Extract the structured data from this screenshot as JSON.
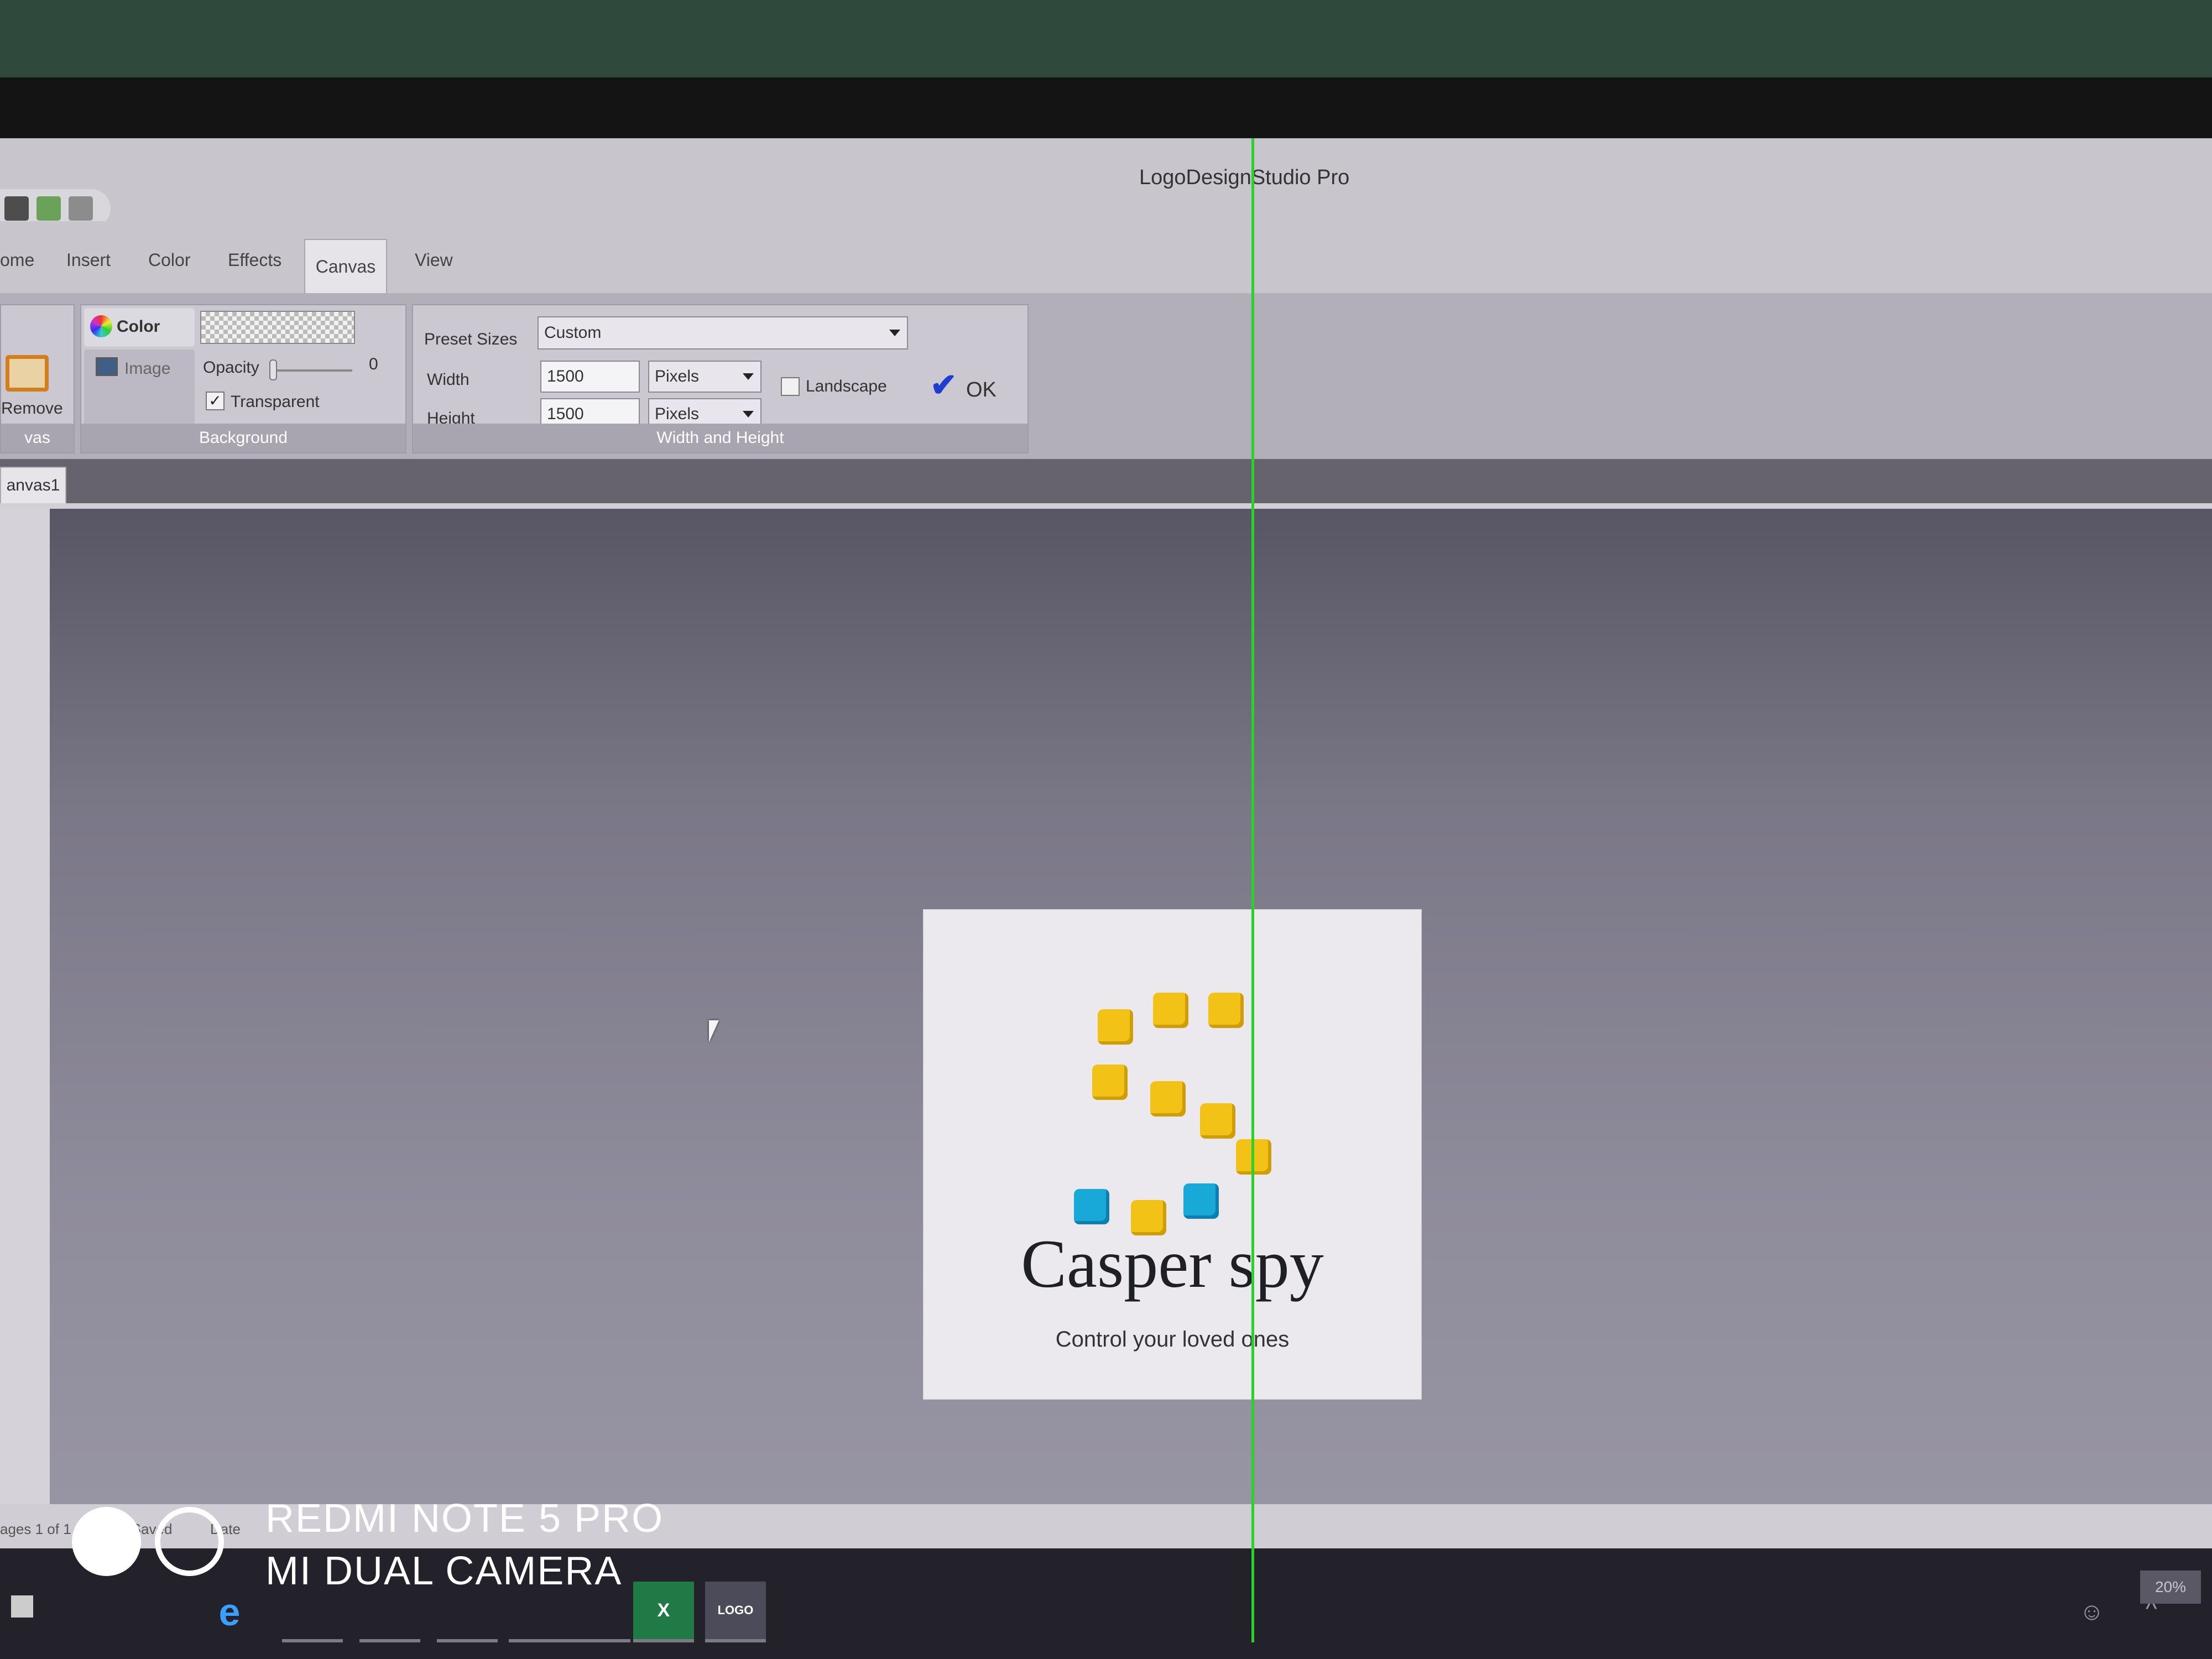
{
  "app": {
    "title": "LogoDesignStudio Pro"
  },
  "ribbon_tabs": [
    "ome",
    "Insert",
    "Color",
    "Effects",
    "Canvas",
    "View"
  ],
  "canvas_group": {
    "remove_label": "Remove",
    "group_label": "vas"
  },
  "background_group": {
    "color_label": "Color",
    "image_label": "Image",
    "opacity_label": "Opacity",
    "opacity_value": "0",
    "transparent_label": "Transparent",
    "transparent_checked": true,
    "group_label": "Background"
  },
  "size_group": {
    "preset_label": "Preset Sizes",
    "preset_value": "Custom",
    "width_label": "Width",
    "width_value": "1500",
    "width_unit": "Pixels",
    "height_label": "Height",
    "height_value": "1500",
    "height_unit": "Pixels",
    "landscape_label": "Landscape",
    "landscape_checked": false,
    "ok_label": "OK",
    "group_label": "Width and Height"
  },
  "document": {
    "tab_label": "anvas1"
  },
  "logo": {
    "name": "Casper spy",
    "tagline": "Control your loved ones",
    "colors": {
      "yellow": "#f2c316",
      "blue": "#19a9d8"
    }
  },
  "status": {
    "pages": "ages 1 of 1",
    "saved": "Not Saved",
    "date": "Date"
  },
  "taskbar": {
    "excel_label": "X",
    "logo_app_label": "LOGO",
    "zoom": "20%"
  },
  "watermark": {
    "line1": "REDMI NOTE 5 PRO",
    "line2": "MI DUAL CAMERA"
  },
  "icons": [
    "save-icon",
    "undo-icon",
    "print-icon",
    "color-wheel-icon",
    "image-icon",
    "checkmark-icon",
    "windows-icon",
    "edge-icon",
    "excel-icon",
    "logo-app-icon",
    "mouse-cursor-icon"
  ]
}
